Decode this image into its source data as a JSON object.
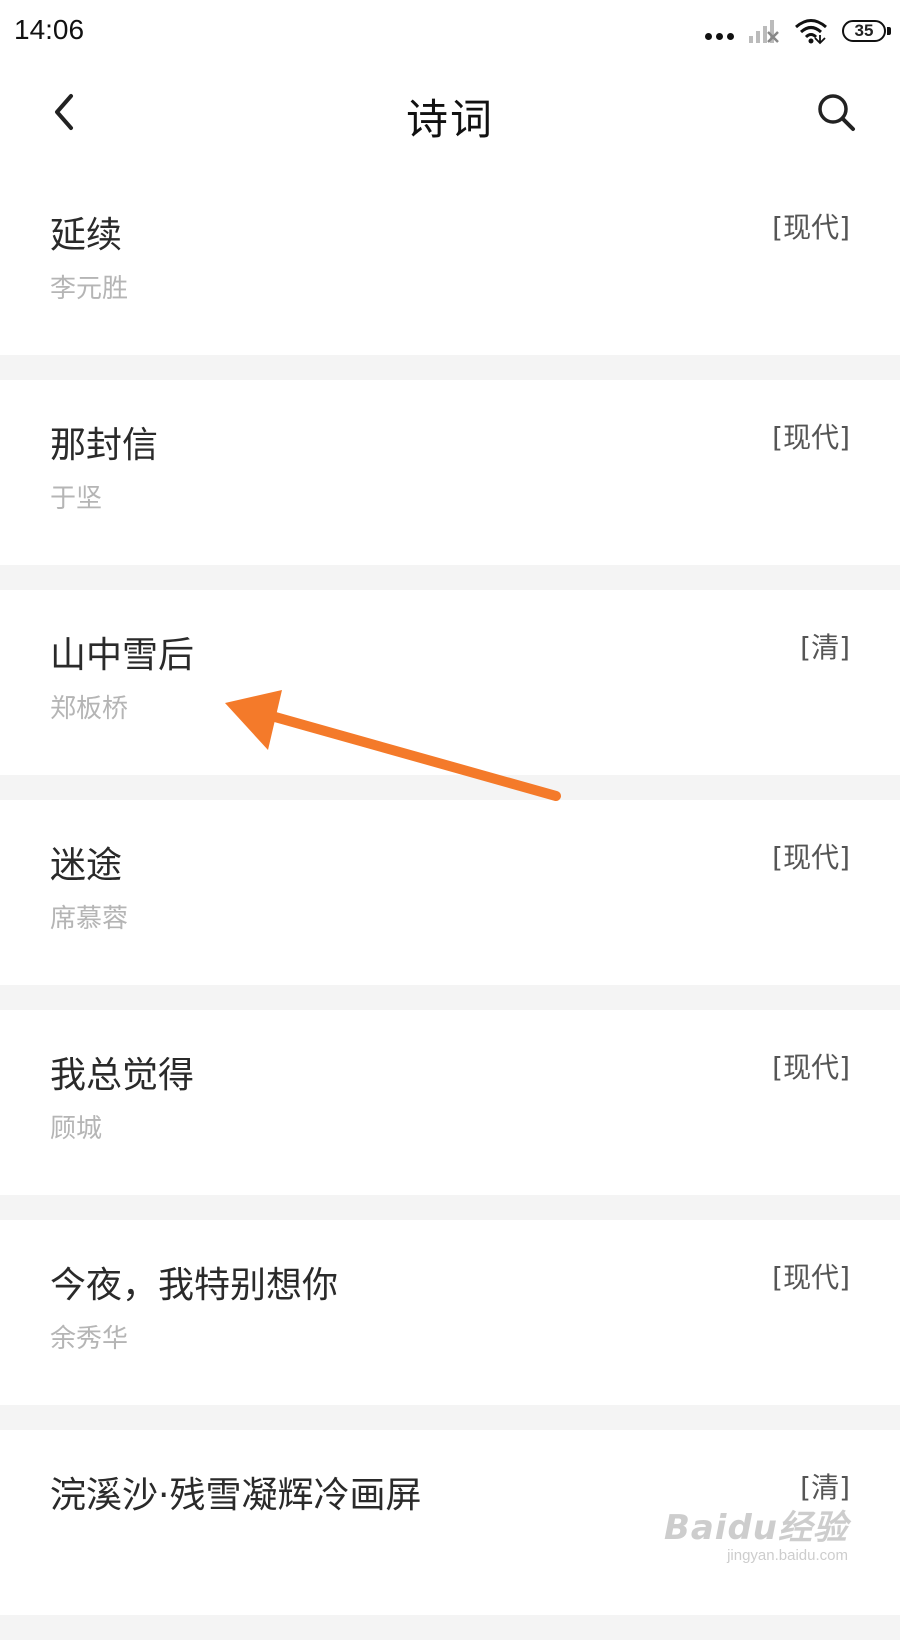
{
  "status_bar": {
    "time": "14:06",
    "battery": "35",
    "icons": [
      "more-dots-icon",
      "signal-off-icon",
      "wifi-icon",
      "battery-icon"
    ]
  },
  "header": {
    "title": "诗词",
    "back_icon": "chevron-left-icon",
    "search_icon": "search-icon"
  },
  "poems": [
    {
      "title": "延续",
      "author": "李元胜",
      "dynasty": "[现代]"
    },
    {
      "title": "那封信",
      "author": "于坚",
      "dynasty": "[现代]"
    },
    {
      "title": "山中雪后",
      "author": "郑板桥",
      "dynasty": "[清]"
    },
    {
      "title": "迷途",
      "author": "席慕蓉",
      "dynasty": "[现代]"
    },
    {
      "title": "我总觉得",
      "author": "顾城",
      "dynasty": "[现代]"
    },
    {
      "title": "今夜，我特别想你",
      "author": "余秀华",
      "dynasty": "[现代]"
    },
    {
      "title": "浣溪沙·残雪凝辉冷画屏",
      "author": "",
      "dynasty": "[清]"
    }
  ],
  "annotation": {
    "color": "#f47a2a",
    "points_to": "山中雪后"
  },
  "watermark": {
    "logo": "Baidu经验",
    "url": "jingyan.baidu.com"
  }
}
